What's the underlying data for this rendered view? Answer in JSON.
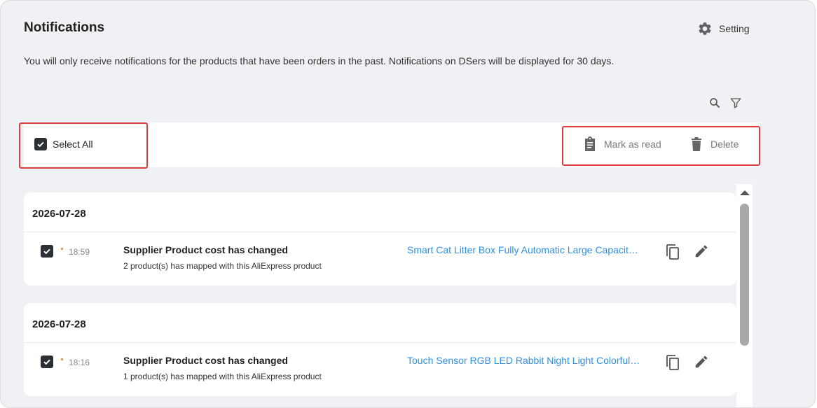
{
  "header": {
    "title": "Notifications",
    "setting_label": "Setting",
    "description": "You will only receive notifications for the products that have been orders in the past. Notifications on DSers will be displayed for 30 days."
  },
  "toolbar": {
    "select_all_label": "Select All",
    "select_all_checked": true,
    "mark_as_read_label": "Mark as read",
    "delete_label": "Delete"
  },
  "notifications": [
    {
      "date": "2026-07-28",
      "checked": true,
      "time": "18:59",
      "title": "Supplier Product cost has changed",
      "subtitle": "2 product(s) has mapped with this AliExpress product",
      "link": "Smart Cat Litter Box Fully Automatic Large Capacity Self Cleaning"
    },
    {
      "date": "2026-07-28",
      "checked": true,
      "time": "18:16",
      "title": "Supplier Product cost has changed",
      "subtitle": "1 product(s) has mapped with this AliExpress product",
      "link": "Touch Sensor RGB LED Rabbit Night Light Colorful Lamp"
    }
  ],
  "icons": {
    "setting": "gear-icon",
    "search": "search-icon",
    "filter": "filter-icon",
    "mark_read": "clipboard-icon",
    "delete": "trash-icon",
    "copy": "copy-icon",
    "edit": "pencil-icon"
  },
  "colors": {
    "link": "#2f8fe6",
    "unread_dot": "#f07b14",
    "highlight": "#e23b3b",
    "checkbox": "#2b2f36"
  }
}
